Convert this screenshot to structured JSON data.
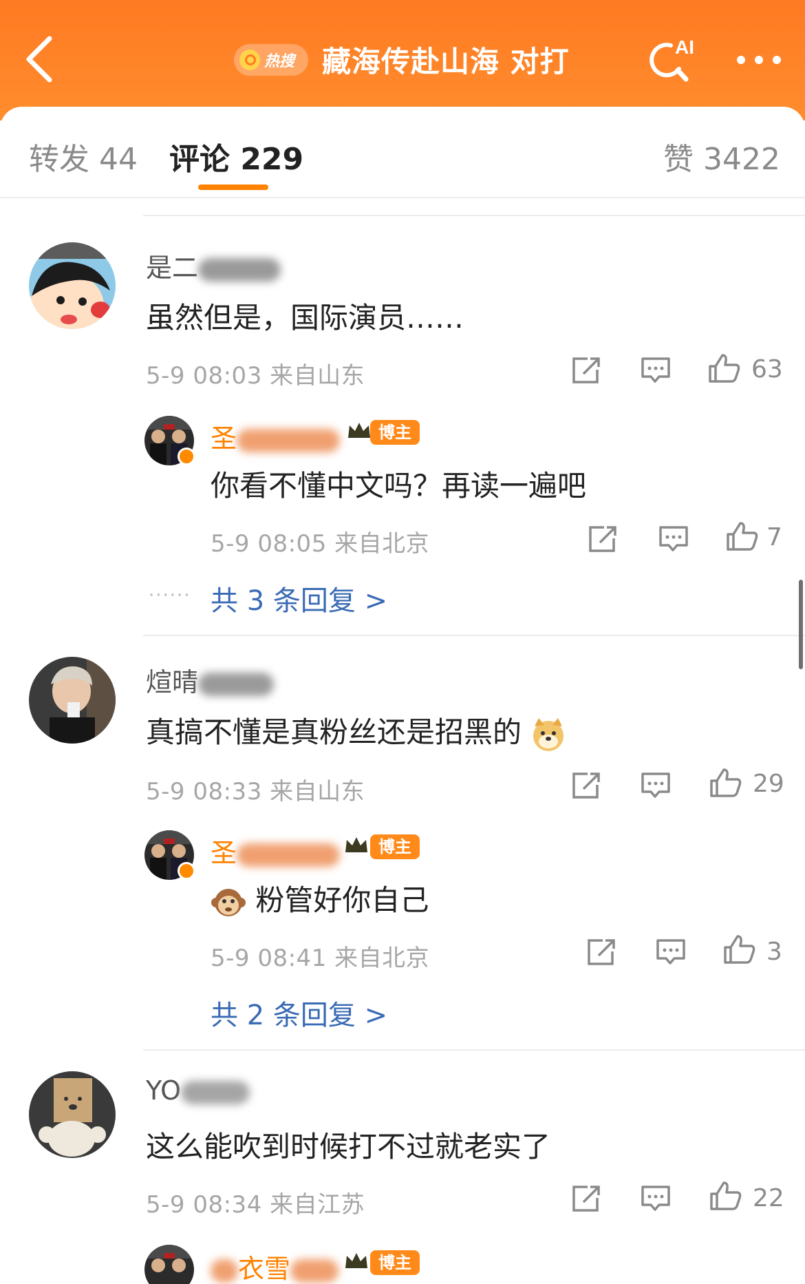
{
  "header": {
    "hot_badge": "热搜",
    "title": "藏海传赴山海 对打",
    "ai_label": "AI",
    "accent_color": "#ff7a22"
  },
  "tabs": {
    "repost": "转发 44",
    "comment": "评论 229",
    "like": "赞 3422"
  },
  "comments": [
    {
      "username": "是二",
      "text": "虽然但是，国际演员……",
      "time": "5-9 08:03",
      "location": "来自山东",
      "likes": "63",
      "reply": {
        "username": "圣",
        "badge": "博主",
        "text": "你看不懂中文吗？再读一遍吧",
        "time": "5-9 08:05",
        "location": "来自北京",
        "likes": "7"
      },
      "more_replies": "共 3 条回复 >"
    },
    {
      "username": "煊晴",
      "text": "真搞不懂是真粉丝还是招黑的",
      "time": "5-9 08:33",
      "location": "来自山东",
      "likes": "29",
      "reply": {
        "username": "圣",
        "badge": "博主",
        "text": "粉管好你自己",
        "time": "5-9 08:41",
        "location": "来自北京",
        "likes": "3"
      },
      "more_replies": "共 2 条回复 >"
    },
    {
      "username": "YO",
      "text": "这么能吹到时候打不过就老实了",
      "time": "5-9 08:34",
      "location": "来自江苏",
      "likes": "22",
      "reply": {
        "username": "衣雪",
        "badge": "博主"
      }
    }
  ],
  "icons": [
    "back-icon",
    "search-icon",
    "ai-search-icon",
    "more-icon",
    "share-icon",
    "comment-icon",
    "like-icon",
    "crown-icon",
    "doge-emoji",
    "monkey-emoji",
    "verified-icon"
  ]
}
